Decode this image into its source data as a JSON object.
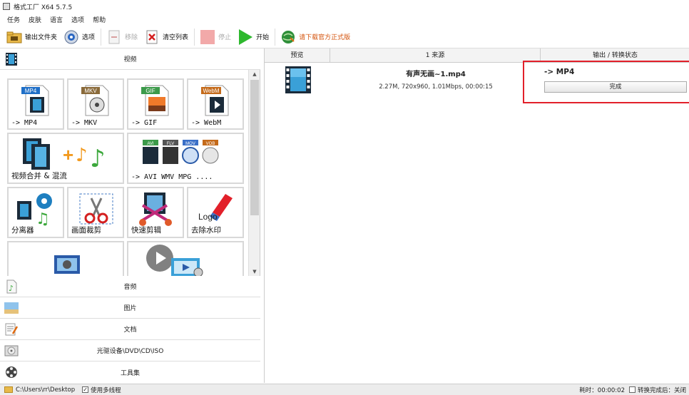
{
  "window": {
    "title": "格式工厂 X64 5.7.5"
  },
  "menu": [
    "任务",
    "皮肤",
    "语言",
    "选项",
    "帮助"
  ],
  "toolbar": {
    "output_folder": "输出文件夹",
    "options": "选项",
    "remove": "移除",
    "clear_list": "清空列表",
    "stop": "停止",
    "start": "开始",
    "download": "请下载官方正式版"
  },
  "left": {
    "video_header": "视频",
    "tiles": [
      {
        "label": "-> MP4",
        "badge": "MP4",
        "badge_color": "#1f6fc7"
      },
      {
        "label": "-> MKV",
        "badge": "MKV",
        "badge_color": "#8a6a3a"
      },
      {
        "label": "-> GIF",
        "badge": "GIF",
        "badge_color": "#3c9a4a"
      },
      {
        "label": "-> WebM",
        "badge": "WebM",
        "badge_color": "#c46a1a"
      },
      {
        "label": "视频合并 & 混流"
      },
      {
        "label": "-> AVI WMV MPG ....",
        "badges": [
          "AVI",
          "FLV",
          "MOV",
          "VOB"
        ]
      },
      {
        "label": "分离器"
      },
      {
        "label": "画面裁剪"
      },
      {
        "label": "快速剪辑"
      },
      {
        "label": "去除水印",
        "logo_text": "Logo"
      },
      {
        "label": ""
      },
      {
        "label": ""
      }
    ],
    "categories": [
      "音频",
      "图片",
      "文档",
      "光驱设备\\DVD\\CD\\ISO",
      "工具集"
    ]
  },
  "right": {
    "headers": [
      "预览",
      "1 来源",
      "输出 / 转换状态"
    ],
    "task": {
      "filename": "有声无画~1.mp4",
      "info": "2.27M, 720x960, 1.01Mbps, 00:00:15",
      "target": "-> MP4",
      "status": "完成"
    }
  },
  "statusbar": {
    "path": "C:\\Users\\rr\\Desktop",
    "multithread": "使用多线程",
    "elapsed": "耗时：00:00:02",
    "after_done": "转换完成后：关闭"
  },
  "colors": {
    "accent_red": "#e2202a",
    "start_green": "#2eb82e"
  }
}
